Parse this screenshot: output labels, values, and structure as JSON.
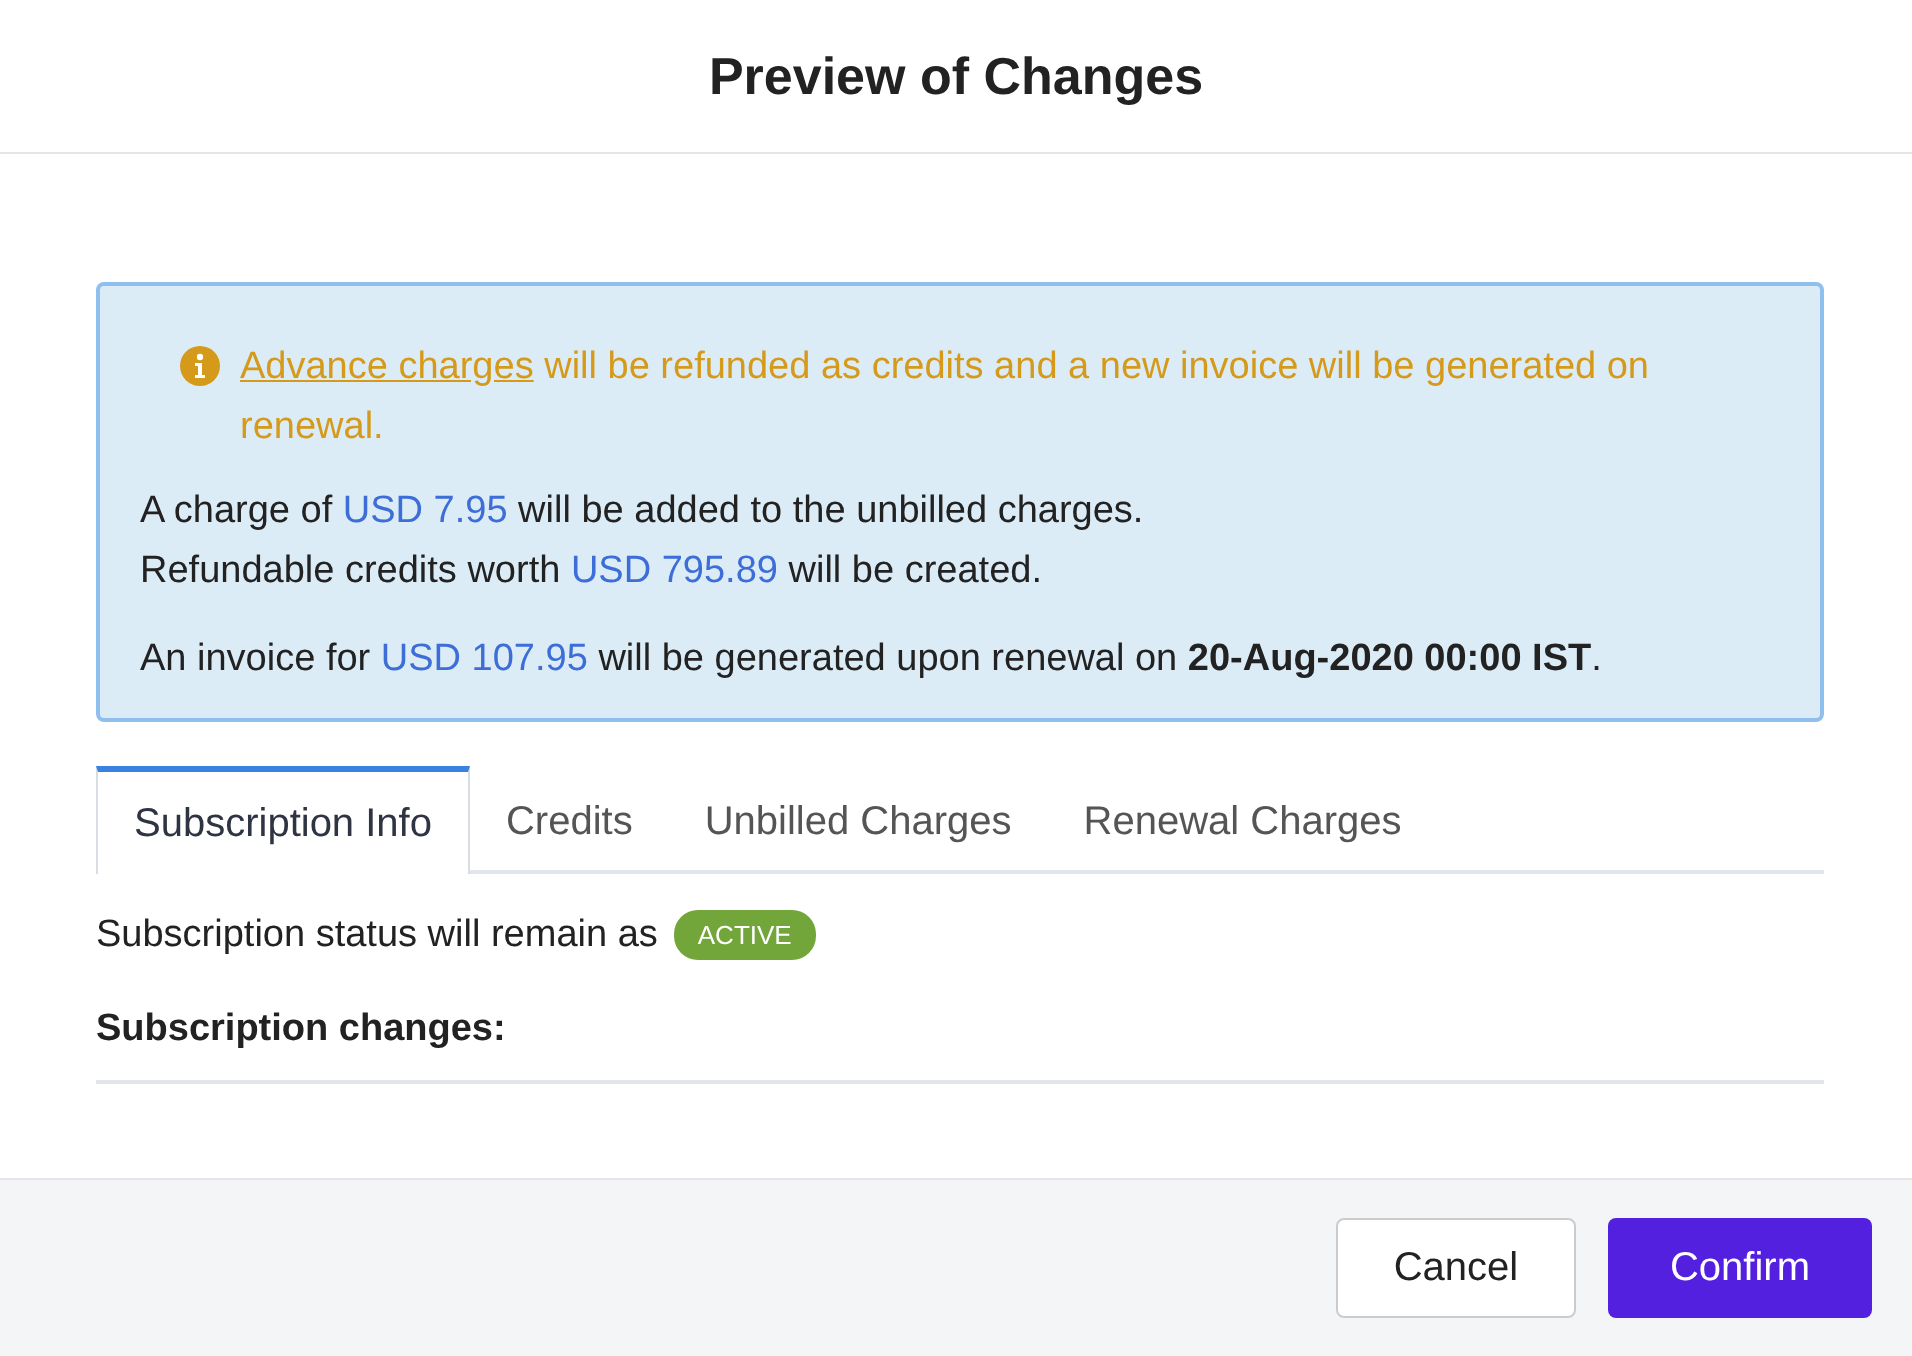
{
  "dialog": {
    "title": "Preview of Changes"
  },
  "notice": {
    "link": "Advance charges",
    "text": " will be refunded as credits and a new invoice will be generated on renewal."
  },
  "summary": [
    {
      "segments": [
        {
          "kind": "plain",
          "text": "A charge of "
        },
        {
          "kind": "amount",
          "text": "USD 7.95"
        },
        {
          "kind": "plain",
          "text": " will be added to the unbilled charges."
        }
      ]
    },
    {
      "segments": [
        {
          "kind": "plain",
          "text": "Refundable credits worth "
        },
        {
          "kind": "amount",
          "text": "USD 795.89"
        },
        {
          "kind": "plain",
          "text": " will be created."
        }
      ]
    },
    {
      "segments": [
        {
          "kind": "plain",
          "text": "An invoice for "
        },
        {
          "kind": "amount",
          "text": "USD 107.95"
        },
        {
          "kind": "plain",
          "text": " will be generated upon renewal on "
        },
        {
          "kind": "bold",
          "text": "20-Aug-2020 00:00 IST"
        },
        {
          "kind": "plain",
          "text": "."
        }
      ]
    }
  ],
  "tabs": [
    {
      "label": "Subscription Info",
      "selected": true
    },
    {
      "label": "Credits",
      "selected": false
    },
    {
      "label": "Unbilled Charges",
      "selected": false
    },
    {
      "label": "Renewal Charges",
      "selected": false
    }
  ],
  "status": {
    "text": "Subscription status will remain as",
    "badge": "ACTIVE"
  },
  "changes_heading": "Subscription changes:",
  "buttons": [
    {
      "label": "Cancel",
      "kind": "secondary"
    },
    {
      "label": "Confirm",
      "kind": "primary"
    }
  ]
}
